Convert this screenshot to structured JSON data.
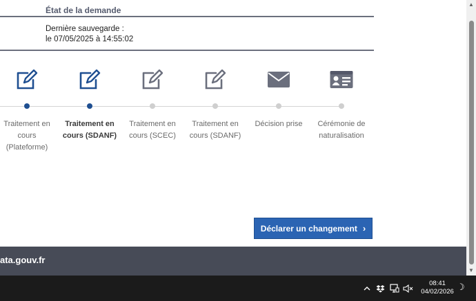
{
  "request": {
    "status_heading": "État de la demande",
    "last_save_label": "Dernière sauvegarde :",
    "last_save_value": "le 07/05/2025 à 14:55:02"
  },
  "timeline": {
    "steps": [
      {
        "label": "Traitement en cours (Plateforme)",
        "icon": "edit-icon",
        "state": "done"
      },
      {
        "label": "Traitement en cours (SDANF)",
        "icon": "edit-icon",
        "state": "current"
      },
      {
        "label": "Traitement en cours (SCEC)",
        "icon": "edit-icon",
        "state": "pending"
      },
      {
        "label": "Traitement en cours (SDANF)",
        "icon": "edit-icon",
        "state": "pending"
      },
      {
        "label": "Décision prise",
        "icon": "envelope-icon",
        "state": "pending"
      },
      {
        "label": "Cérémonie de naturalisation",
        "icon": "id-card-icon",
        "state": "pending"
      }
    ]
  },
  "actions": {
    "declare_change_label": "Déclarer un changement",
    "declare_change_chevron": "›"
  },
  "footer": {
    "text": "ata.gouv.fr"
  },
  "taskbar": {
    "time": "08:41",
    "date": "04/02/2026"
  },
  "colors": {
    "active_blue": "#1f4f91",
    "button_blue": "#2b64b3",
    "icon_active": "#1f4f91",
    "icon_pending": "#6b6f7d",
    "footer_bg": "#474b57"
  }
}
